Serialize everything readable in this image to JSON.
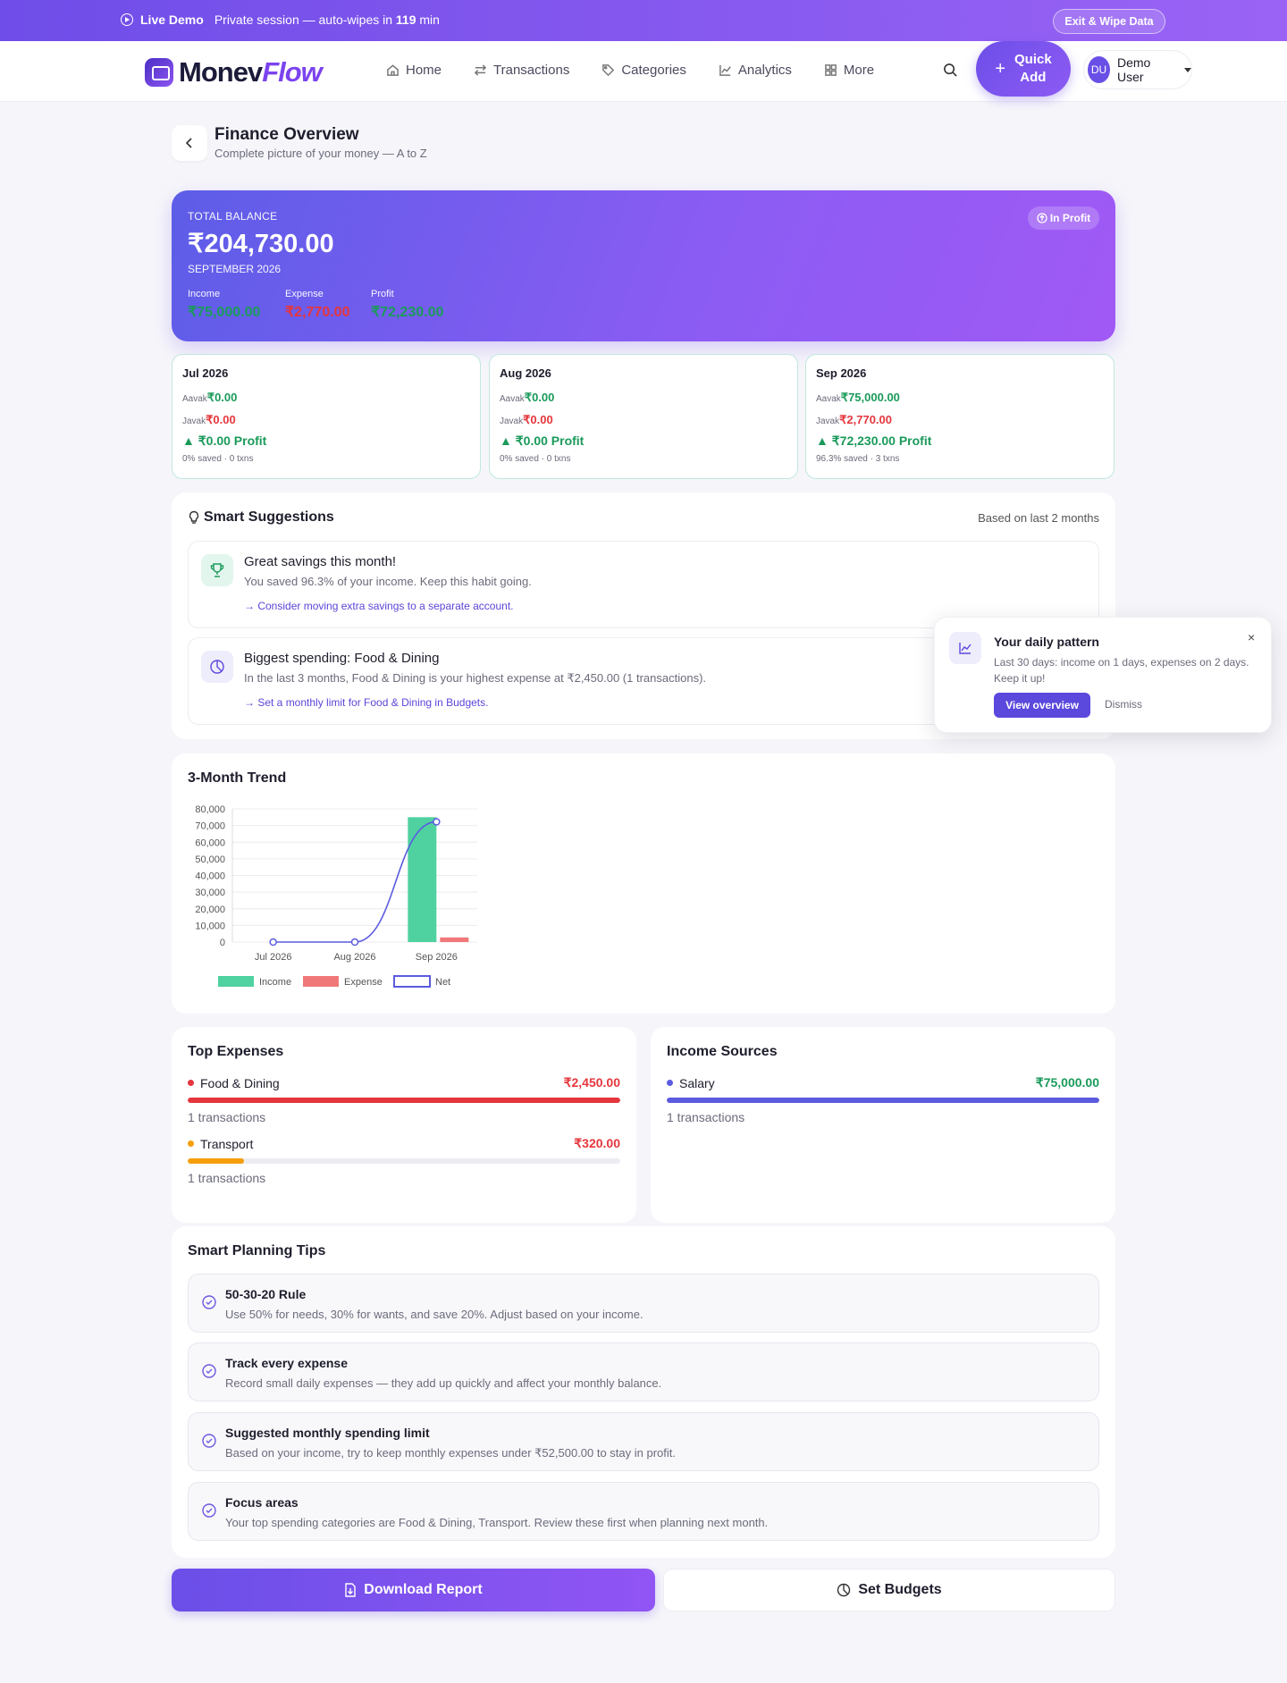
{
  "demo_bar": {
    "badge": "Live Demo",
    "message": "Private session — auto-wipes in ",
    "minutes": "119",
    "unit": " min",
    "exit_label": "Exit & Wipe Data"
  },
  "nav": {
    "brand_a": "Monev",
    "brand_b": "Flow",
    "links": [
      {
        "label": "Home",
        "icon": "home-icon"
      },
      {
        "label": "Transactions",
        "icon": "arrows-swap-icon"
      },
      {
        "label": "Categories",
        "icon": "tag-icon"
      },
      {
        "label": "Analytics",
        "icon": "line-chart-icon"
      },
      {
        "label": "More",
        "icon": "grid-icon"
      }
    ],
    "quick_add_line1": "Quick",
    "quick_add_line2": "Add",
    "user_initials": "DU",
    "user_name": "Demo User"
  },
  "page": {
    "title": "Finance Overview",
    "subtitle": "Complete picture of your money — A to Z"
  },
  "hero": {
    "label": "TOTAL BALANCE",
    "amount": "₹204,730.00",
    "month": "SEPTEMBER 2026",
    "status": "In Profit",
    "income_label": "Income",
    "income": "₹75,000.00",
    "expense_label": "Expense",
    "expense": "₹2,770.00",
    "profit_label": "Profit",
    "profit": "₹72,230.00"
  },
  "months": [
    {
      "title": "Jul 2026",
      "aavak_label": "Aavak",
      "aavak": "₹0.00",
      "javak_label": "Javak",
      "javak": "₹0.00",
      "profit": "▲ ₹0.00 Profit",
      "foot": "0% saved · 0 txns"
    },
    {
      "title": "Aug 2026",
      "aavak_label": "Aavak",
      "aavak": "₹0.00",
      "javak_label": "Javak",
      "javak": "₹0.00",
      "profit": "▲ ₹0.00 Profit",
      "foot": "0% saved · 0 txns"
    },
    {
      "title": "Sep 2026",
      "aavak_label": "Aavak",
      "aavak": "₹75,000.00",
      "javak_label": "Javak",
      "javak": "₹2,770.00",
      "profit": "▲ ₹72,230.00 Profit",
      "foot": "96.3% saved · 3 txns"
    }
  ],
  "suggestions": {
    "title": "Smart Suggestions",
    "basis": "Based on last 2 months",
    "items": [
      {
        "title": "Great savings this month!",
        "desc": "You saved 96.3% of your income. Keep this habit going.",
        "action": "→ Consider moving extra savings to a separate account.",
        "icon": "trophy-icon",
        "color": "#e3f6ee"
      },
      {
        "title": "Biggest spending: Food & Dining",
        "desc": "In the last 3 months, Food & Dining is your highest expense at ₹2,450.00 (1 transactions).",
        "action": "→ Set a monthly limit for Food & Dining in Budgets.",
        "icon": "pie-chart-icon",
        "color": "#eeedfb"
      }
    ]
  },
  "toast": {
    "title": "Your daily pattern",
    "desc": "Last 30 days: income on 1 days, expenses on 2 days. Keep it up!",
    "primary": "View overview",
    "secondary": "Dismiss",
    "close": "×"
  },
  "trend": {
    "title": "3-Month Trend"
  },
  "chart_data": {
    "type": "bar",
    "categories": [
      "Jul 2026",
      "Aug 2026",
      "Sep 2026"
    ],
    "series": [
      {
        "name": "Income",
        "type": "bar",
        "values": [
          0,
          0,
          75000
        ],
        "color": "#4fd1a0"
      },
      {
        "name": "Expense",
        "type": "bar",
        "values": [
          0,
          0,
          2770
        ],
        "color": "#f07878"
      },
      {
        "name": "Net",
        "type": "line",
        "values": [
          0,
          0,
          72230
        ],
        "color": "#5b5be0"
      }
    ],
    "yticks": [
      "80,000",
      "70,000",
      "60,000",
      "50,000",
      "40,000",
      "30,000",
      "20,000",
      "10,000",
      "0"
    ],
    "ylim": [
      0,
      80000
    ],
    "grid": true,
    "legend_position": "bottom"
  },
  "top_expenses": {
    "title": "Top Expenses",
    "items": [
      {
        "name": "Food & Dining",
        "amount": "₹2,450.00",
        "sub": "1 transactions",
        "share": 1.0,
        "color": "#e5363d"
      },
      {
        "name": "Transport",
        "amount": "₹320.00",
        "sub": "1 transactions",
        "share": 0.13,
        "color": "#f59e0b"
      }
    ]
  },
  "income_sources": {
    "title": "Income Sources",
    "items": [
      {
        "name": "Salary",
        "amount": "₹75,000.00",
        "sub": "1 transactions",
        "share": 1.0,
        "color": "#5b5be0"
      }
    ]
  },
  "tips": {
    "title": "Smart Planning Tips",
    "items": [
      {
        "title": "50-30-20 Rule",
        "desc": "Use 50% for needs, 30% for wants, and save 20%. Adjust based on your income."
      },
      {
        "title": "Track every expense",
        "desc": "Record small daily expenses — they add up quickly and affect your monthly balance."
      },
      {
        "title": "Suggested monthly spending limit",
        "desc": "Based on your income, try to keep monthly expenses under ₹52,500.00 to stay in profit."
      },
      {
        "title": "Focus areas",
        "desc": "Your top spending categories are Food & Dining, Transport. Review these first when planning next month."
      }
    ]
  },
  "actions": {
    "download": "Download Report",
    "budgets": "Set Budgets"
  }
}
